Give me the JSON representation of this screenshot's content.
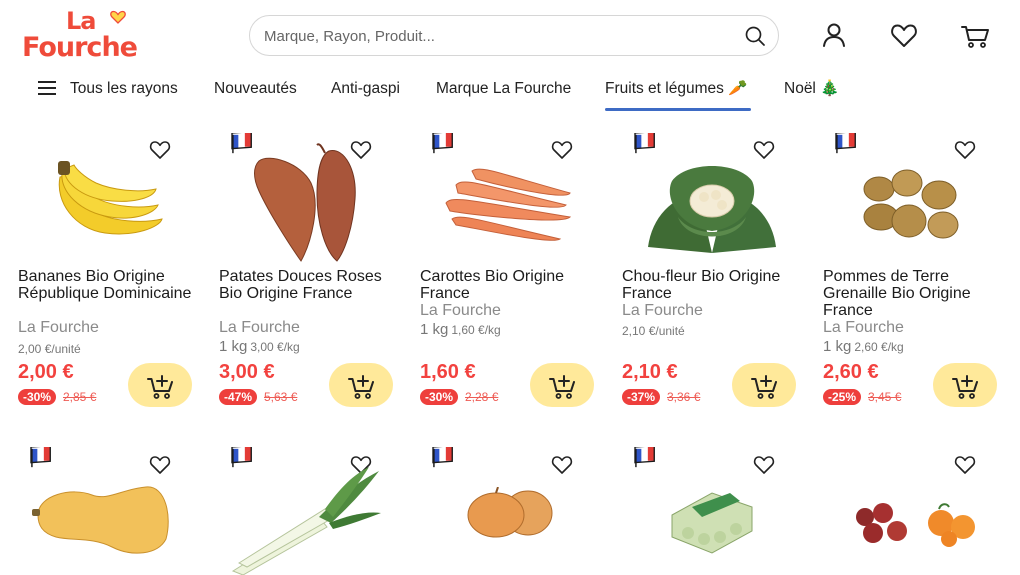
{
  "brand": {
    "logo_line1": "La",
    "logo_line2": "Fourche"
  },
  "search": {
    "placeholder": "Marque, Rayon, Produit..."
  },
  "nav": {
    "all_departments": "Tous les rayons",
    "items": [
      {
        "label": "Nouveautés"
      },
      {
        "label": "Anti-gaspi"
      },
      {
        "label": "Marque La Fourche"
      },
      {
        "label": "Fruits et légumes 🥕"
      },
      {
        "label": "Noël 🎄"
      }
    ],
    "active_index": 3,
    "active_color": "#3e6bc4"
  },
  "colors": {
    "brand": "#ef4b3a",
    "price": "#f2423f",
    "cart_button": "#ffe99a"
  },
  "products": [
    {
      "name": "Bananes Bio Origine République Dominicaine",
      "brand": "La Fourche",
      "qty": "",
      "unit_price": "2,00 €/unité",
      "price": "2,00 €",
      "discount": "-30%",
      "old_price": "2,85 €",
      "flag": false,
      "image": "banana"
    },
    {
      "name": "Patates Douces Roses Bio Origine France",
      "brand": "La Fourche",
      "qty": "1 kg",
      "unit_price": "3,00 €/kg",
      "price": "3,00 €",
      "discount": "-47%",
      "old_price": "5,63 €",
      "flag": true,
      "image": "sweet-potato"
    },
    {
      "name": "Carottes Bio Origine France",
      "brand": "La Fourche",
      "qty": "1 kg",
      "unit_price": "1,60 €/kg",
      "price": "1,60 €",
      "discount": "-30%",
      "old_price": "2,28 €",
      "flag": true,
      "image": "carrot"
    },
    {
      "name": "Chou-fleur Bio Origine France",
      "brand": "La Fourche",
      "qty": "",
      "unit_price": "2,10 €/unité",
      "price": "2,10 €",
      "discount": "-37%",
      "old_price": "3,36 €",
      "flag": true,
      "image": "cauliflower"
    },
    {
      "name": "Pommes de Terre Grenaille Bio Origine France",
      "brand": "La Fourche",
      "qty": "1 kg",
      "unit_price": "2,60 €/kg",
      "price": "2,60 €",
      "discount": "-25%",
      "old_price": "3,45 €",
      "flag": true,
      "image": "potato"
    }
  ],
  "products_row2": [
    {
      "flag": true,
      "image": "butternut"
    },
    {
      "flag": true,
      "image": "leek"
    },
    {
      "flag": true,
      "image": "onion"
    },
    {
      "flag": true,
      "image": "eggs"
    },
    {
      "flag": false,
      "image": "apple-clementine"
    }
  ]
}
